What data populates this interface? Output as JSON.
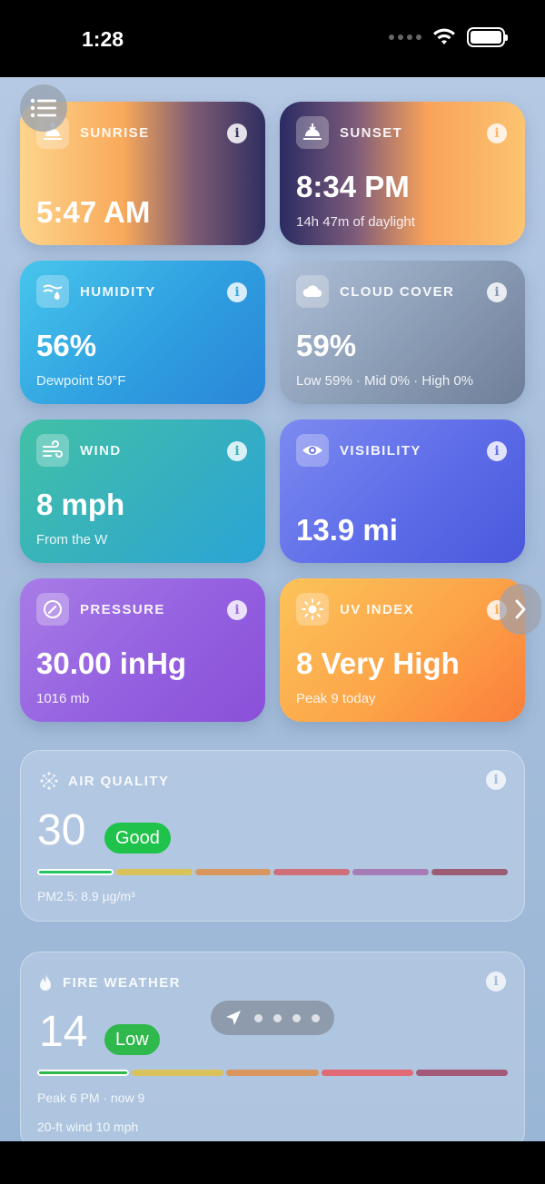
{
  "status_bar": {
    "time": "1:28"
  },
  "cards": {
    "sunrise": {
      "title": "SUNRISE",
      "value": "5:47 AM",
      "info": "i"
    },
    "sunset": {
      "title": "SUNSET",
      "value": "8:34 PM",
      "sub": "14h 47m of daylight",
      "info": "i"
    },
    "humidity": {
      "title": "HUMIDITY",
      "value": "56%",
      "sub": "Dewpoint 50°F",
      "info": "i"
    },
    "cloud_cover": {
      "title": "CLOUD COVER",
      "value": "59%",
      "sub": "Low 59% · Mid 0% · High 0%",
      "info": "i"
    },
    "wind": {
      "title": "WIND",
      "value": "8 mph",
      "sub": "From the W",
      "info": "i"
    },
    "visibility": {
      "title": "VISIBILITY",
      "value": "13.9 mi",
      "info": "i"
    },
    "pressure": {
      "title": "PRESSURE",
      "value": "30.00 inHg",
      "sub": "1016 mb",
      "info": "i"
    },
    "uv_index": {
      "title": "UV INDEX",
      "value": "8 Very High",
      "sub": "Peak 9 today",
      "info": "i"
    }
  },
  "air_quality": {
    "title": "AIR QUALITY",
    "value": "30",
    "badge": "Good",
    "badge_color": "#1fc24a",
    "detail": "PM2.5: 8.9 µg/m³",
    "scale_colors": [
      "#22c55e",
      "#d9c25a",
      "#d9965e",
      "#cf6f78",
      "#a77bb6",
      "#9a5d74"
    ],
    "active_index": 0,
    "info": "i"
  },
  "fire_weather": {
    "title": "FIRE WEATHER",
    "value": "14",
    "badge": "Low",
    "badge_color": "#2fb84b",
    "detail_1": "Peak 6 PM · now 9",
    "detail_2": "20-ft wind 10 mph",
    "scale_colors": [
      "#2fb84b",
      "#d9c25a",
      "#d9965e",
      "#e06b74",
      "#a35a78"
    ],
    "active_index": 0,
    "info": "i"
  },
  "page_indicator": {
    "dots": 4
  }
}
